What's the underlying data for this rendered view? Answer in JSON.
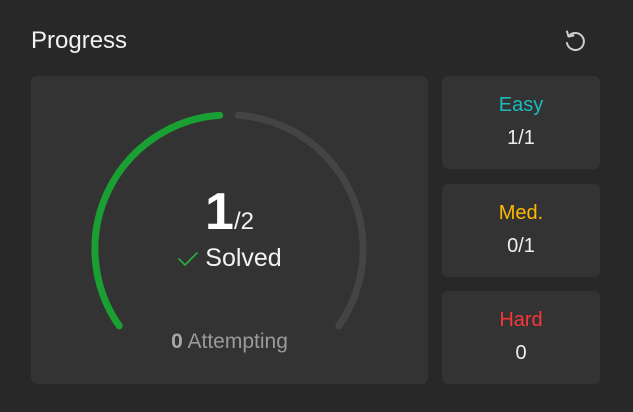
{
  "header": {
    "title": "Progress",
    "reset_icon": "reset-icon"
  },
  "summary": {
    "solved": "1",
    "total": "/2",
    "solved_label": "Solved",
    "solved_fraction": 0.5,
    "attempting_count": "0",
    "attempting_label": "Attempting"
  },
  "difficulties": [
    {
      "label": "Easy",
      "value": "1/1",
      "color": "#1cbbba"
    },
    {
      "label": "Med.",
      "value": "0/1",
      "color": "#ffb700"
    },
    {
      "label": "Hard",
      "value": "0",
      "color": "#f63737"
    }
  ],
  "colors": {
    "progress": "#1a9f33",
    "track": "#444444",
    "check": "#2aa845"
  }
}
